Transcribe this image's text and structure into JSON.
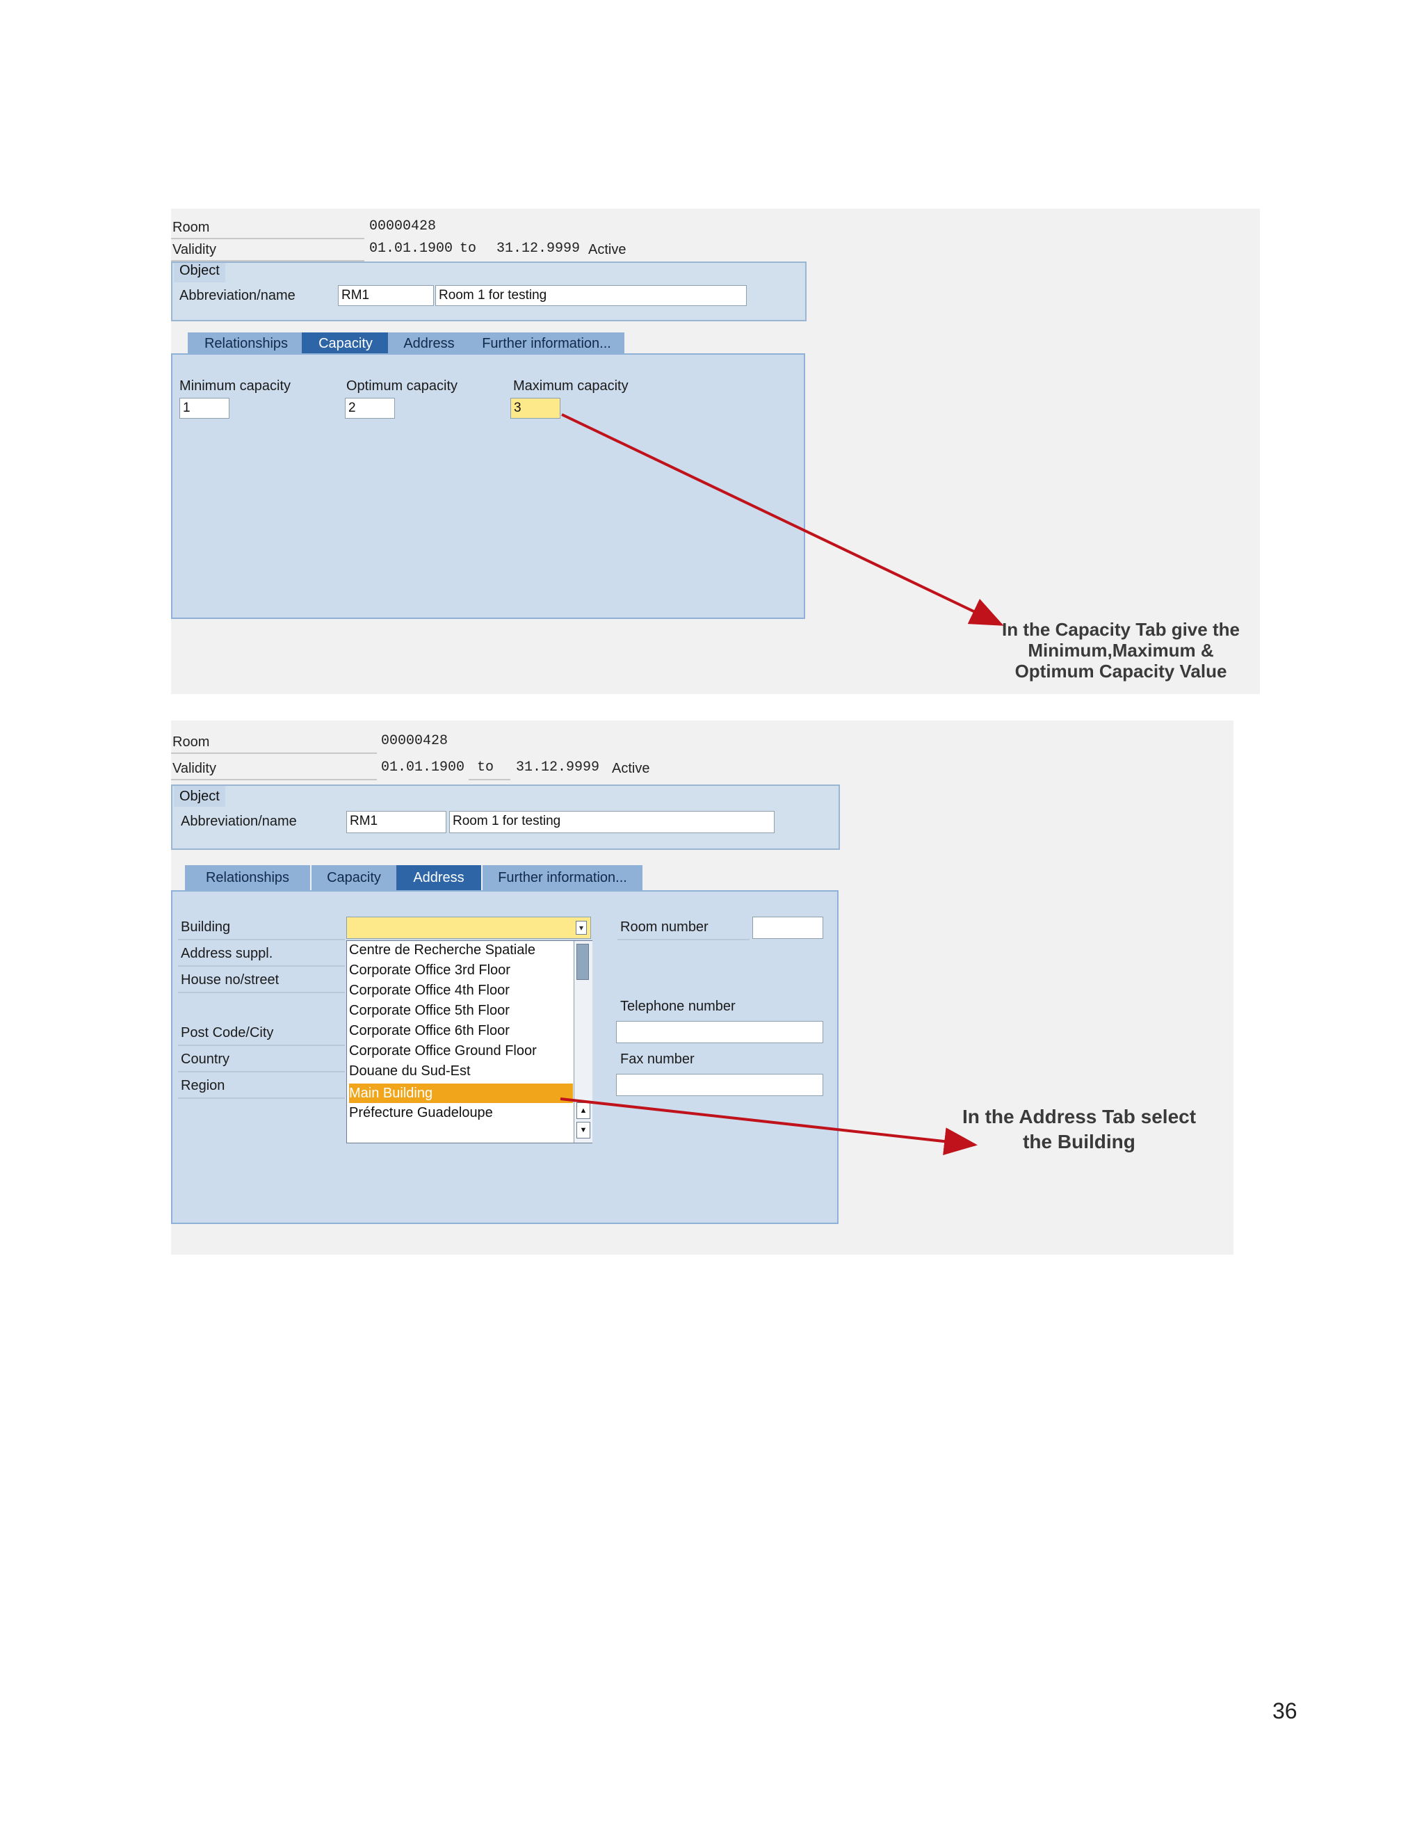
{
  "screenshot1": {
    "header": {
      "room_label": "Room",
      "room_value": "00000428",
      "validity_label": "Validity",
      "validity_from": "01.01.1900",
      "validity_to_label": "to",
      "validity_to": "31.12.9999",
      "status": "Active"
    },
    "object": {
      "tab_label": "Object",
      "abbrev_label": "Abbreviation/name",
      "abbrev_value": "RM1",
      "name_value": "Room 1 for testing"
    },
    "tabs": [
      "Relationships",
      "Capacity",
      "Address",
      "Further information..."
    ],
    "active_tab": "Capacity",
    "capacity": {
      "min_label": "Minimum capacity",
      "min_value": "1",
      "opt_label": "Optimum capacity",
      "opt_value": "2",
      "max_label": "Maximum capacity",
      "max_value": "3"
    },
    "callout": [
      "In the Capacity Tab give the",
      "Minimum,Maximum &",
      "Optimum Capacity Value"
    ]
  },
  "screenshot2": {
    "header": {
      "room_label": "Room",
      "room_value": "00000428",
      "validity_label": "Validity",
      "validity_from": "01.01.1900",
      "validity_to_label": "to",
      "validity_to": "31.12.9999",
      "status": "Active"
    },
    "object": {
      "tab_label": "Object",
      "abbrev_label": "Abbreviation/name",
      "abbrev_value": "RM1",
      "name_value": "Room 1 for testing"
    },
    "tabs": [
      "Relationships",
      "Capacity",
      "Address",
      "Further information..."
    ],
    "active_tab": "Address",
    "address": {
      "building_label": "Building",
      "address_suppl_label": "Address suppl.",
      "house_label": "House no/street",
      "postcode_label": "Post Code/City",
      "country_label": "Country",
      "region_label": "Region",
      "room_number_label": "Room number",
      "telephone_label": "Telephone number",
      "fax_label": "Fax number",
      "building_options": [
        "Centre de Recherche Spatiale",
        "Corporate Office 3rd Floor",
        "Corporate Office 4th Floor",
        "Corporate Office 5th Floor",
        "Corporate Office 6th Floor",
        "Corporate Office Ground Floor",
        "Douane du Sud-Est",
        "Main Building",
        "Préfecture Guadeloupe"
      ],
      "selected_option": "Main Building"
    },
    "callout": [
      "In the Address Tab select",
      "the Building"
    ]
  },
  "page_number": "36",
  "colors": {
    "panel": "#cddced",
    "tab": "#8fb0d7",
    "tab_active": "#2d65a6",
    "highlight_field": "#fde98a",
    "selection": "#f0a51a",
    "arrow": "#c0121a"
  }
}
